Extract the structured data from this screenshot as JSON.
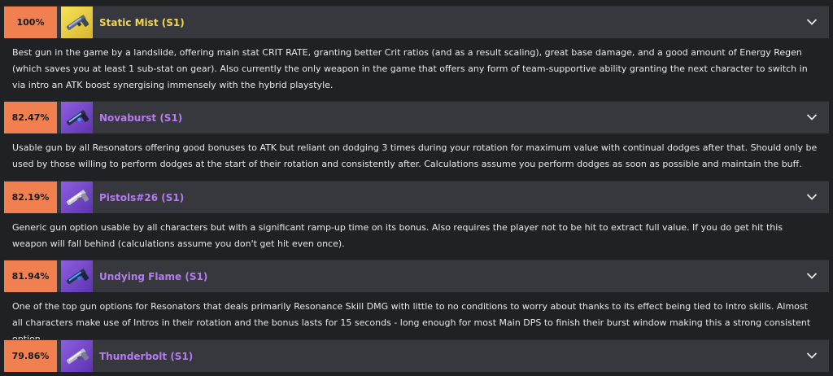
{
  "weapons": [
    {
      "percent": "100%",
      "name": "Static Mist (S1)",
      "rarity_color": "gold",
      "icon": "pistol-icon",
      "description": "Best gun in the game by a landslide, offering main stat CRIT RATE, granting better Crit ratios (and as a result scaling), great base damage, and a good amount of Energy Regen (which saves you at least 1 sub-stat on gear). Also currently the only weapon in the game that offers any form of team-supportive ability granting the next character to switch in via intro an ATK boost synergising immensely with the hybrid playstyle."
    },
    {
      "percent": "82.47%",
      "name": "Novaburst (S1)",
      "rarity_color": "purple",
      "icon": "pistol-icon",
      "description": "Usable gun by all Resonators offering good bonuses to ATK but reliant on dodging 3 times during your rotation for maximum value with continual dodges after that. Should only be used by those willing to perform dodges at the start of their rotation and consistently after. Calculations assume you perform dodges as soon as possible and maintain the buff."
    },
    {
      "percent": "82.19%",
      "name": "Pistols#26 (S1)",
      "rarity_color": "purple",
      "icon": "pistol-icon",
      "description": "Generic gun option usable by all characters but with a significant ramp-up time on its bonus. Also requires the player not to be hit to extract full value. If you do get hit this weapon will fall behind (calculations assume you don't get hit even once)."
    },
    {
      "percent": "81.94%",
      "name": "Undying Flame (S1)",
      "rarity_color": "purple",
      "icon": "pistol-icon",
      "description": "One of the top gun options for Resonators that deals primarily Resonance Skill DMG with little to no conditions to worry about thanks to its effect being tied to Intro skills. Almost all characters make use of Intros in their rotation and the bonus lasts for 15 seconds - long enough for most Main DPS to finish their burst window making this a strong consistent option."
    },
    {
      "percent": "79.86%",
      "name": "Thunderbolt (S1)",
      "rarity_color": "purple",
      "icon": "pistol-icon",
      "description": ""
    }
  ]
}
